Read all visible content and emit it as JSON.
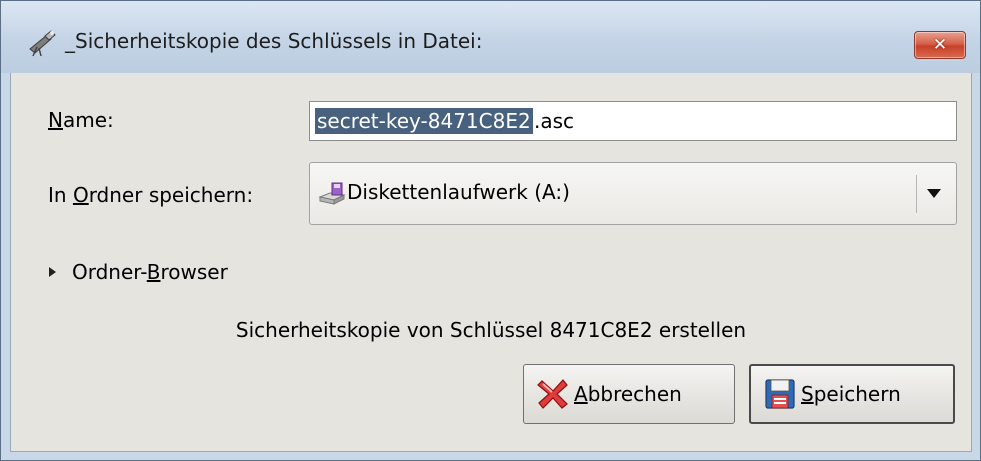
{
  "window": {
    "title": "_Sicherheitskopie des Schlüssels in Datei:",
    "close_label": "✕"
  },
  "form": {
    "name_label_first": "N",
    "name_label_rest": "ame:",
    "name_value_selected": "secret-key-8471C8E2",
    "name_value_ext": ".asc",
    "folder_label_pre": "In ",
    "folder_label_ul": "O",
    "folder_label_post": "rdner speichern:",
    "folder_value": "Diskettenlaufwerk (A:)",
    "browser_pre": "Ordner-",
    "browser_ul": "B",
    "browser_post": "rowser"
  },
  "info_text": "Sicherheitskopie von Schlüssel 8471C8E2 erstellen",
  "buttons": {
    "cancel_ul": "A",
    "cancel_rest": "bbrechen",
    "save_ul": "S",
    "save_rest": "peichern"
  },
  "icons": {
    "title": "telescope-icon",
    "drive": "floppy-drive-icon",
    "cancel": "red-x-icon",
    "save": "floppy-disk-icon"
  }
}
